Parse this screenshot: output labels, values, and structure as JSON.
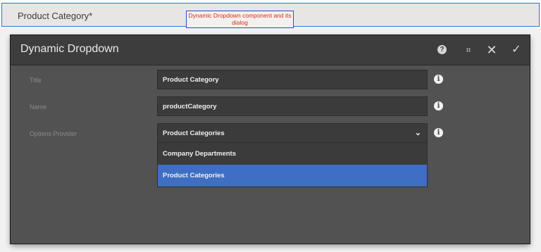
{
  "component": {
    "label": "Product Category*",
    "callout": "Dynamic Dropdown component and its dialog"
  },
  "dialog": {
    "title": "Dynamic Dropdown",
    "buttons": {
      "help": "?",
      "fullscreen": "⌗",
      "close": "✕",
      "done": "✓"
    },
    "fields": [
      {
        "label": "Title",
        "value": "Product Category"
      },
      {
        "label": "Name",
        "value": "productCategory"
      },
      {
        "label": "Options Provider",
        "value": "Product Categories"
      }
    ],
    "dropdown_options": [
      {
        "label": "Company Departments",
        "selected": false
      },
      {
        "label": "Product Categories",
        "selected": true
      }
    ],
    "info_glyph": "i",
    "chevron": "⌄"
  },
  "colors": {
    "accent": "#3f6fc4",
    "dialog_bg": "#525252",
    "header_bg": "#3d3d3d",
    "callout_text": "#d92b1c"
  }
}
